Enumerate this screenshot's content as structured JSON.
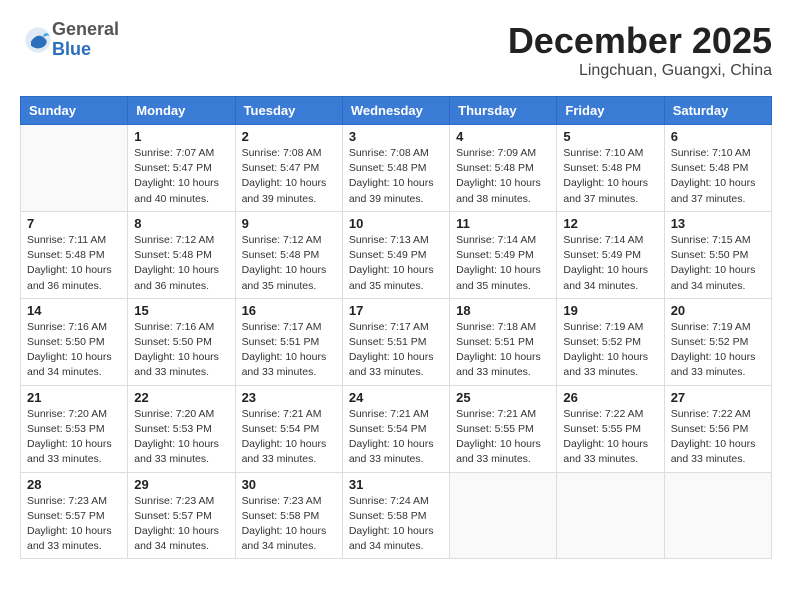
{
  "header": {
    "logo": {
      "general": "General",
      "blue": "Blue"
    },
    "title": "December 2025",
    "location": "Lingchuan, Guangxi, China"
  },
  "calendar": {
    "days_of_week": [
      "Sunday",
      "Monday",
      "Tuesday",
      "Wednesday",
      "Thursday",
      "Friday",
      "Saturday"
    ],
    "weeks": [
      [
        {
          "day": "",
          "info": ""
        },
        {
          "day": "1",
          "info": "Sunrise: 7:07 AM\nSunset: 5:47 PM\nDaylight: 10 hours\nand 40 minutes."
        },
        {
          "day": "2",
          "info": "Sunrise: 7:08 AM\nSunset: 5:47 PM\nDaylight: 10 hours\nand 39 minutes."
        },
        {
          "day": "3",
          "info": "Sunrise: 7:08 AM\nSunset: 5:48 PM\nDaylight: 10 hours\nand 39 minutes."
        },
        {
          "day": "4",
          "info": "Sunrise: 7:09 AM\nSunset: 5:48 PM\nDaylight: 10 hours\nand 38 minutes."
        },
        {
          "day": "5",
          "info": "Sunrise: 7:10 AM\nSunset: 5:48 PM\nDaylight: 10 hours\nand 37 minutes."
        },
        {
          "day": "6",
          "info": "Sunrise: 7:10 AM\nSunset: 5:48 PM\nDaylight: 10 hours\nand 37 minutes."
        }
      ],
      [
        {
          "day": "7",
          "info": "Sunrise: 7:11 AM\nSunset: 5:48 PM\nDaylight: 10 hours\nand 36 minutes."
        },
        {
          "day": "8",
          "info": "Sunrise: 7:12 AM\nSunset: 5:48 PM\nDaylight: 10 hours\nand 36 minutes."
        },
        {
          "day": "9",
          "info": "Sunrise: 7:12 AM\nSunset: 5:48 PM\nDaylight: 10 hours\nand 35 minutes."
        },
        {
          "day": "10",
          "info": "Sunrise: 7:13 AM\nSunset: 5:49 PM\nDaylight: 10 hours\nand 35 minutes."
        },
        {
          "day": "11",
          "info": "Sunrise: 7:14 AM\nSunset: 5:49 PM\nDaylight: 10 hours\nand 35 minutes."
        },
        {
          "day": "12",
          "info": "Sunrise: 7:14 AM\nSunset: 5:49 PM\nDaylight: 10 hours\nand 34 minutes."
        },
        {
          "day": "13",
          "info": "Sunrise: 7:15 AM\nSunset: 5:50 PM\nDaylight: 10 hours\nand 34 minutes."
        }
      ],
      [
        {
          "day": "14",
          "info": "Sunrise: 7:16 AM\nSunset: 5:50 PM\nDaylight: 10 hours\nand 34 minutes."
        },
        {
          "day": "15",
          "info": "Sunrise: 7:16 AM\nSunset: 5:50 PM\nDaylight: 10 hours\nand 33 minutes."
        },
        {
          "day": "16",
          "info": "Sunrise: 7:17 AM\nSunset: 5:51 PM\nDaylight: 10 hours\nand 33 minutes."
        },
        {
          "day": "17",
          "info": "Sunrise: 7:17 AM\nSunset: 5:51 PM\nDaylight: 10 hours\nand 33 minutes."
        },
        {
          "day": "18",
          "info": "Sunrise: 7:18 AM\nSunset: 5:51 PM\nDaylight: 10 hours\nand 33 minutes."
        },
        {
          "day": "19",
          "info": "Sunrise: 7:19 AM\nSunset: 5:52 PM\nDaylight: 10 hours\nand 33 minutes."
        },
        {
          "day": "20",
          "info": "Sunrise: 7:19 AM\nSunset: 5:52 PM\nDaylight: 10 hours\nand 33 minutes."
        }
      ],
      [
        {
          "day": "21",
          "info": "Sunrise: 7:20 AM\nSunset: 5:53 PM\nDaylight: 10 hours\nand 33 minutes."
        },
        {
          "day": "22",
          "info": "Sunrise: 7:20 AM\nSunset: 5:53 PM\nDaylight: 10 hours\nand 33 minutes."
        },
        {
          "day": "23",
          "info": "Sunrise: 7:21 AM\nSunset: 5:54 PM\nDaylight: 10 hours\nand 33 minutes."
        },
        {
          "day": "24",
          "info": "Sunrise: 7:21 AM\nSunset: 5:54 PM\nDaylight: 10 hours\nand 33 minutes."
        },
        {
          "day": "25",
          "info": "Sunrise: 7:21 AM\nSunset: 5:55 PM\nDaylight: 10 hours\nand 33 minutes."
        },
        {
          "day": "26",
          "info": "Sunrise: 7:22 AM\nSunset: 5:55 PM\nDaylight: 10 hours\nand 33 minutes."
        },
        {
          "day": "27",
          "info": "Sunrise: 7:22 AM\nSunset: 5:56 PM\nDaylight: 10 hours\nand 33 minutes."
        }
      ],
      [
        {
          "day": "28",
          "info": "Sunrise: 7:23 AM\nSunset: 5:57 PM\nDaylight: 10 hours\nand 33 minutes."
        },
        {
          "day": "29",
          "info": "Sunrise: 7:23 AM\nSunset: 5:57 PM\nDaylight: 10 hours\nand 34 minutes."
        },
        {
          "day": "30",
          "info": "Sunrise: 7:23 AM\nSunset: 5:58 PM\nDaylight: 10 hours\nand 34 minutes."
        },
        {
          "day": "31",
          "info": "Sunrise: 7:24 AM\nSunset: 5:58 PM\nDaylight: 10 hours\nand 34 minutes."
        },
        {
          "day": "",
          "info": ""
        },
        {
          "day": "",
          "info": ""
        },
        {
          "day": "",
          "info": ""
        }
      ]
    ]
  }
}
